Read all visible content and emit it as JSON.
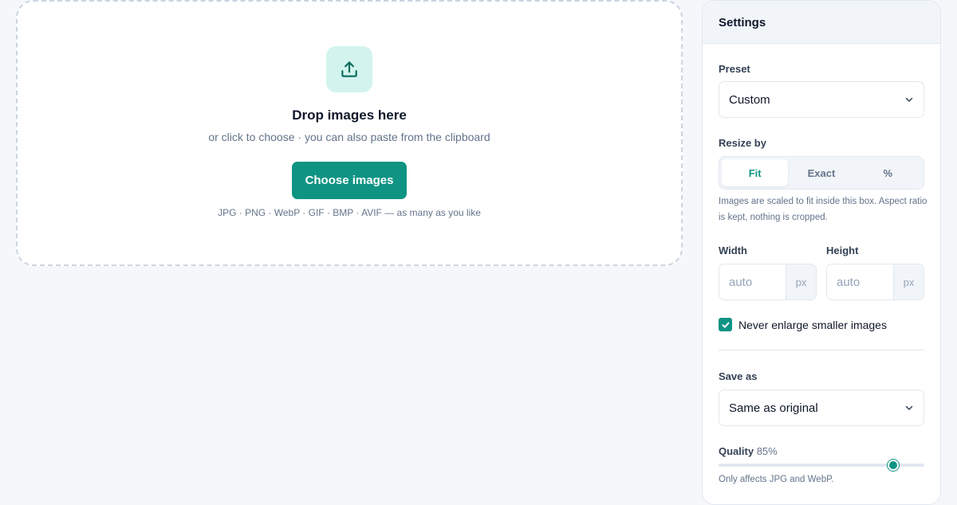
{
  "dropzone": {
    "icon": "upload-icon",
    "title": "Drop images here",
    "subtitle": "or click to choose · you can also paste from the clipboard",
    "button_label": "Choose images",
    "formats": "JPG · PNG · WebP · GIF · BMP · AVIF — as many as you like"
  },
  "settings": {
    "title": "Settings",
    "preset": {
      "label": "Preset",
      "value": "Custom"
    },
    "resize_by": {
      "label": "Resize by",
      "options": [
        "Fit",
        "Exact",
        "%"
      ],
      "selected": "Fit",
      "help": "Images are scaled to fit inside this box. Aspect ratio is kept, nothing is cropped."
    },
    "width": {
      "label": "Width",
      "placeholder": "auto",
      "unit": "px"
    },
    "height": {
      "label": "Height",
      "placeholder": "auto",
      "unit": "px"
    },
    "never_enlarge": {
      "label": "Never enlarge smaller images",
      "checked": true
    },
    "save_as": {
      "label": "Save as",
      "value": "Same as original"
    },
    "quality": {
      "label": "Quality",
      "value_text": "85%",
      "value": 85,
      "help": "Only affects JPG and WebP."
    }
  },
  "colors": {
    "accent": "#0f9484",
    "accent_light": "#d3f4ee",
    "background": "#f6f7fb"
  }
}
